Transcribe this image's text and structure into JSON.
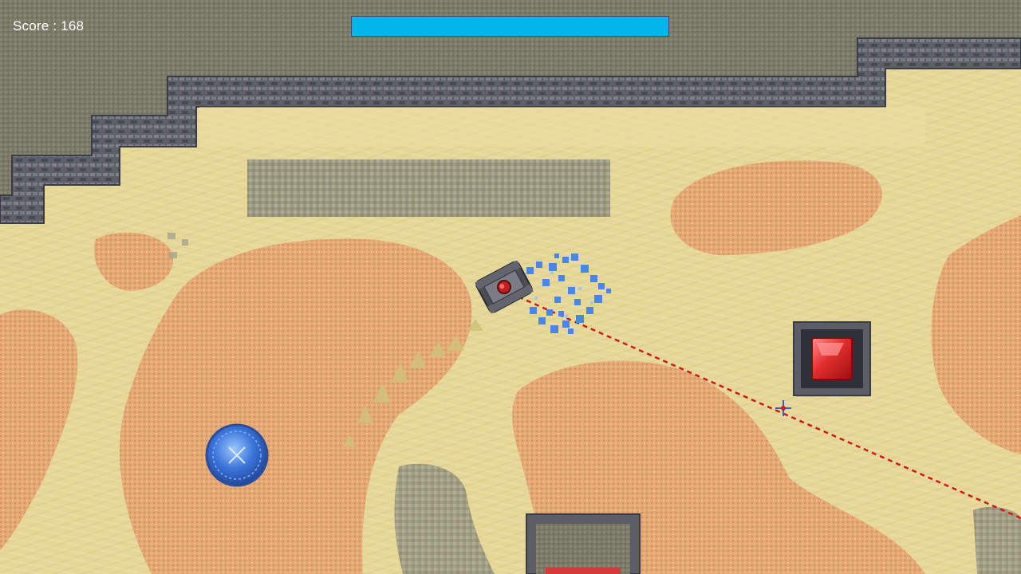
{
  "hud": {
    "score_label": "Score : 168",
    "health_fraction": 1.0
  },
  "icons": {
    "player": "armored-tank-icon",
    "mana_orb": "blue-energy-orb-icon",
    "gem": "red-crystal-icon",
    "crosshair": "crosshair-icon"
  },
  "colors": {
    "health_bar": "#00b6ea",
    "sand": "#e6d797",
    "clay": "#e3a773",
    "stone_wall": "#585b63",
    "laser": "#d01818",
    "gem": "#e03030",
    "orb": "#3a72d8"
  }
}
